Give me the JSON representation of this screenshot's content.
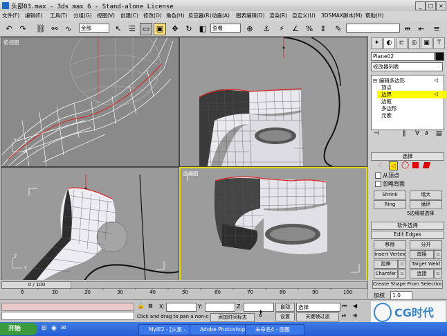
{
  "window": {
    "title": "头部03.max - 3ds max 6 - Stand-alone License",
    "controls": [
      "_",
      "□",
      "×"
    ]
  },
  "menu": [
    "文件(F)",
    "编辑(E)",
    "工具(T)",
    "分组(G)",
    "视图(V)",
    "创建(C)",
    "修改(O)",
    "角色(H)",
    "反应器(R)",
    "动画(A)",
    "图表编辑(D)",
    "渲染(R)",
    "自定义(U)",
    "3DSMAX脚本(M)",
    "帮助(H)"
  ],
  "toolbar": {
    "selection_filter": "全部",
    "reference_coord": "查看"
  },
  "viewports": {
    "top_left": "俯视图",
    "bottom_right": "透视图"
  },
  "command_panel": {
    "object_name": "Plane02",
    "modifier_list": "修改器列表",
    "stack": [
      "编辑多边形",
      "顶点",
      "边界",
      "边框",
      "多边形",
      "元素"
    ],
    "stack_selected": "边界",
    "selection_rollout": "选择",
    "by_vertex": "从顶点",
    "ignore_backfacing": "忽略背面",
    "shrink": "Shrink",
    "grow": "增大",
    "ring": "Ring",
    "loop": "循环",
    "edges_selected": "5边缘被选择",
    "soft_selection": "软件选择",
    "edit_edges": "Edit Edges",
    "remove": "移除",
    "split": "分开",
    "insert_vertex": "Insert Vertex",
    "weld": "焊接",
    "extrude": "拉伸",
    "target_weld": "Target Weld",
    "chamfer": "Chamfer",
    "connect": "连接",
    "create_shape": "Create Shape From Selection",
    "weight_label": "加权",
    "weight_value": "1.0"
  },
  "timeline": {
    "frame": "0 / 100",
    "ticks": [
      "0",
      "10",
      "20",
      "30",
      "40",
      "50",
      "60",
      "70",
      "80",
      "90",
      "100"
    ]
  },
  "status": {
    "x_label": "X:",
    "y_label": "Y:",
    "z_label": "Z:",
    "prompt": "Click and drag to pan a non-came",
    "add_time_tag": "添加时间标志",
    "auto_key": "自动",
    "set_key": "设置",
    "key_filter": "选择",
    "key_filters": "关键帧过滤"
  },
  "taskbar": {
    "start": "开始",
    "tasks": [
      "MyIE2 - [火星...",
      "Adobe Photoshop",
      "未命名4 - 画图"
    ],
    "watermark": "CG时代"
  }
}
